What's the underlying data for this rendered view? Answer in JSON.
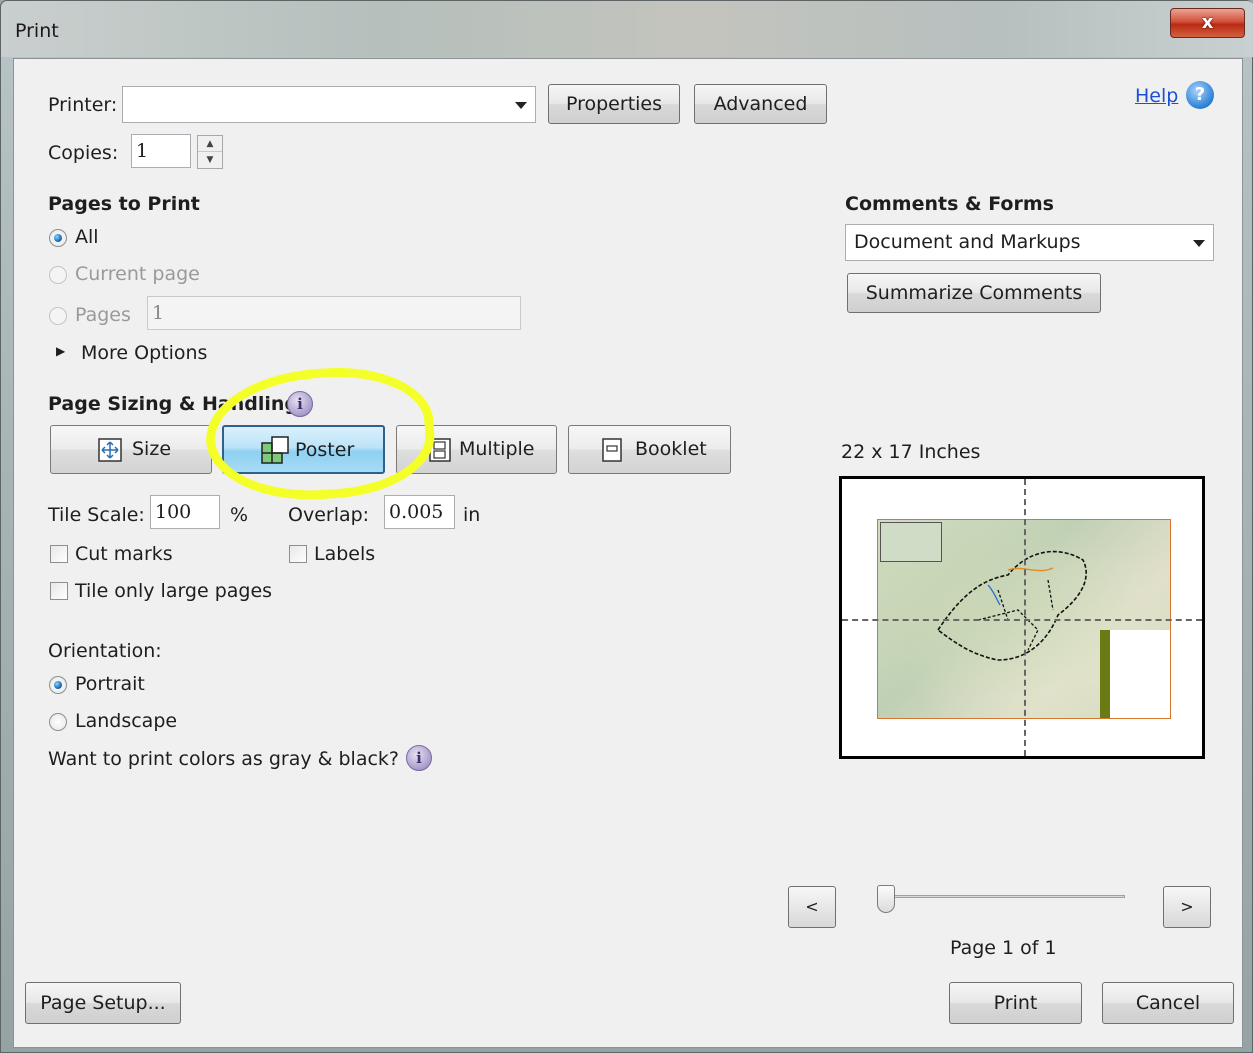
{
  "window": {
    "title": "Print",
    "close_glyph": "x"
  },
  "printer": {
    "label": "Printer:",
    "value": "",
    "properties_label": "Properties",
    "advanced_label": "Advanced"
  },
  "help": {
    "label": "Help",
    "icon": "help-icon"
  },
  "copies": {
    "label": "Copies:",
    "value": "1"
  },
  "pages_to_print": {
    "heading": "Pages to Print",
    "all_label": "All",
    "current_label": "Current page",
    "pages_label": "Pages",
    "pages_value": "1",
    "more_options_label": "More Options",
    "selected": "All"
  },
  "comments_forms": {
    "heading": "Comments & Forms",
    "value": "Document and Markups",
    "summarize_label": "Summarize Comments"
  },
  "sizing": {
    "heading": "Page Sizing & Handling",
    "size_label": "Size",
    "poster_label": "Poster",
    "multiple_label": "Multiple",
    "booklet_label": "Booklet",
    "active": "Poster"
  },
  "poster_options": {
    "tile_scale_label": "Tile Scale:",
    "tile_scale_value": "100",
    "percent": "%",
    "overlap_label": "Overlap:",
    "overlap_value": "0.005",
    "overlap_unit": "in",
    "cut_marks_label": "Cut marks",
    "labels_label": "Labels",
    "tile_large_label": "Tile only large pages"
  },
  "orientation": {
    "heading": "Orientation:",
    "portrait_label": "Portrait",
    "landscape_label": "Landscape",
    "selected": "Portrait"
  },
  "gray_question": "Want to print colors as gray & black?",
  "preview": {
    "size_label": "22 x 17 Inches",
    "page_label": "Page 1 of 1",
    "prev": "<",
    "next": ">"
  },
  "footer": {
    "page_setup_label": "Page Setup...",
    "print_label": "Print",
    "cancel_label": "Cancel"
  },
  "colors": {
    "highlight": "#f4ff29",
    "active_button": "#bde3f8",
    "close_button": "#c9412a"
  }
}
